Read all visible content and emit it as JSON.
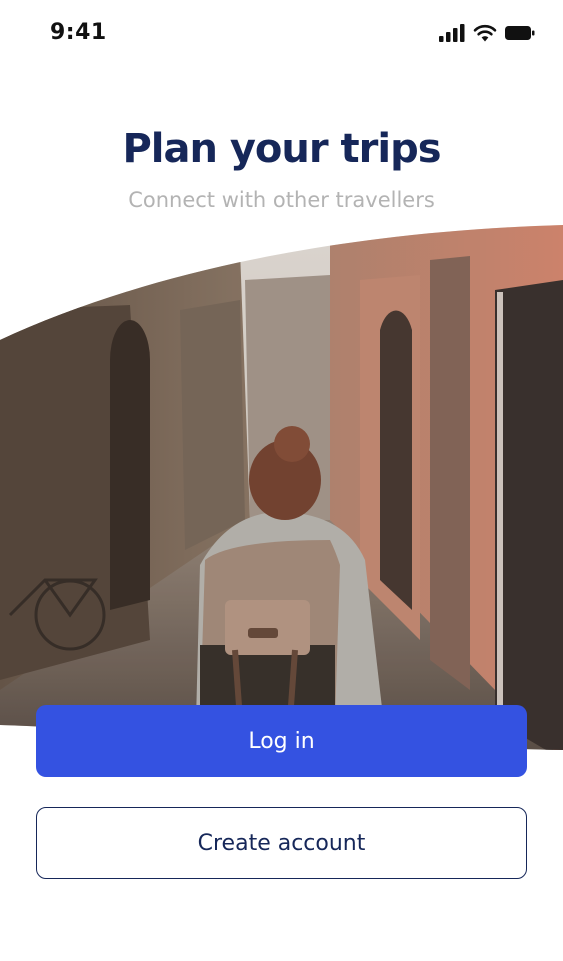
{
  "status_bar": {
    "time": "9:41",
    "icons": [
      "cellular-signal-icon",
      "wifi-icon",
      "battery-icon"
    ]
  },
  "header": {
    "title": "Plan your trips",
    "subtitle": "Connect with other travellers"
  },
  "hero": {
    "image_description": "traveller-with-backpack-in-narrow-alley"
  },
  "actions": {
    "login_label": "Log in",
    "create_account_label": "Create account"
  },
  "colors": {
    "title": "#162759",
    "subtitle": "#b3b3b3",
    "primary": "#3452e1",
    "outline": "#162759"
  }
}
